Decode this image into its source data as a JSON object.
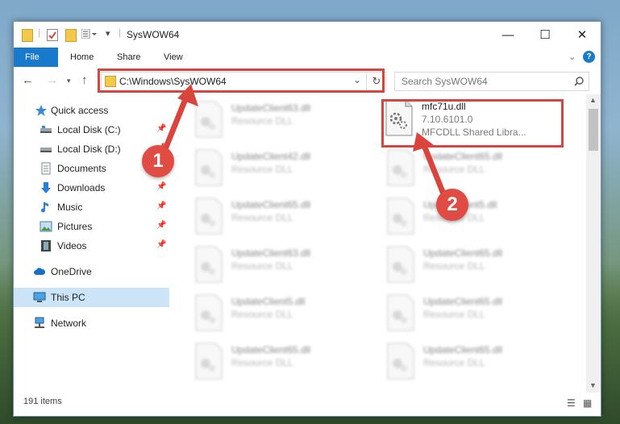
{
  "window": {
    "title": "SysWOW64"
  },
  "ribbon": {
    "tabs": [
      "File",
      "Home",
      "Share",
      "View"
    ]
  },
  "address": {
    "path": "C:\\Windows\\SysWOW64",
    "search_placeholder": "Search SysWOW64"
  },
  "sidebar": {
    "items": [
      {
        "label": "Quick access",
        "icon": "star-icon",
        "pinned": false
      },
      {
        "label": "Local Disk (C:)",
        "icon": "drive-icon",
        "pinned": true
      },
      {
        "label": "Local Disk (D:)",
        "icon": "drive-icon",
        "pinned": true
      },
      {
        "label": "Documents",
        "icon": "documents-icon",
        "pinned": true
      },
      {
        "label": "Downloads",
        "icon": "download-icon",
        "pinned": true
      },
      {
        "label": "Music",
        "icon": "music-icon",
        "pinned": true
      },
      {
        "label": "Pictures",
        "icon": "pictures-icon",
        "pinned": true
      },
      {
        "label": "Videos",
        "icon": "videos-icon",
        "pinned": true
      },
      {
        "label": "OneDrive",
        "icon": "cloud-icon",
        "pinned": false
      },
      {
        "label": "This PC",
        "icon": "computer-icon",
        "pinned": false,
        "selected": true
      },
      {
        "label": "Network",
        "icon": "network-icon",
        "pinned": false
      }
    ]
  },
  "files": {
    "highlighted": {
      "name": "mfc71u.dll",
      "version": "7.10.6101.0",
      "description": "MFCDLL Shared Libra..."
    },
    "left_column": [
      {
        "name": "UpdateClient63.dll",
        "type": "Resource DLL"
      },
      {
        "name": "UpdateClient42.dll",
        "type": "Resource DLL"
      },
      {
        "name": "UpdateClient65.dll",
        "type": "Resource DLL"
      },
      {
        "name": "UpdateClient63.dll",
        "type": "Resource DLL"
      },
      {
        "name": "UpdateClient5.dll",
        "type": "Resource DLL"
      },
      {
        "name": "UpdateClient65.dll",
        "type": "Resource DLL"
      }
    ],
    "right_column": [
      {
        "name": "UpdateClient65.dll",
        "type": "Resource DLL"
      },
      {
        "name": "UpdateClient5.dll",
        "type": "Resource DLL"
      },
      {
        "name": "UpdateClient65.dll",
        "type": "Resource DLL"
      },
      {
        "name": "UpdateClient65.dll",
        "type": "Resource DLL"
      },
      {
        "name": "UpdateClient65.dll",
        "type": "Resource DLL"
      }
    ]
  },
  "status": {
    "item_count": "191 items"
  },
  "annotations": {
    "step1": "1",
    "step2": "2",
    "color": "#d9453d"
  }
}
